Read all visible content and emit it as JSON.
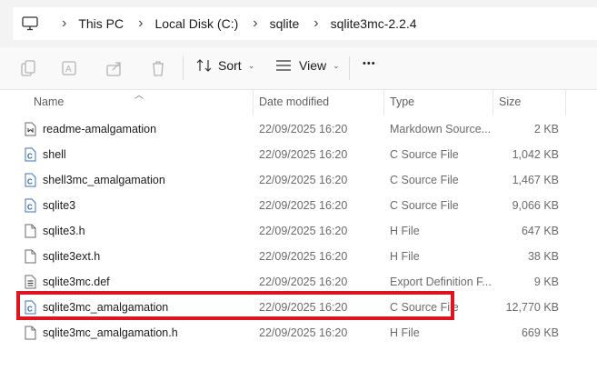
{
  "breadcrumb": [
    "This PC",
    "Local Disk (C:)",
    "sqlite",
    "sqlite3mc-2.2.4"
  ],
  "toolbar": {
    "sort_label": "Sort",
    "view_label": "View",
    "more_label": "•••"
  },
  "columns": {
    "name": "Name",
    "date": "Date modified",
    "type": "Type",
    "size": "Size"
  },
  "files": [
    {
      "name": "readme-amalgamation",
      "date": "22/09/2025 16:20",
      "type": "Markdown Source...",
      "size": "2 KB",
      "icon": "markdown-file-icon"
    },
    {
      "name": "shell",
      "date": "22/09/2025 16:20",
      "type": "C Source File",
      "size": "1,042 KB",
      "icon": "c-source-file-icon"
    },
    {
      "name": "shell3mc_amalgamation",
      "date": "22/09/2025 16:20",
      "type": "C Source File",
      "size": "1,467 KB",
      "icon": "c-source-file-icon"
    },
    {
      "name": "sqlite3",
      "date": "22/09/2025 16:20",
      "type": "C Source File",
      "size": "9,066 KB",
      "icon": "c-source-file-icon"
    },
    {
      "name": "sqlite3.h",
      "date": "22/09/2025 16:20",
      "type": "H File",
      "size": "647 KB",
      "icon": "blank-file-icon"
    },
    {
      "name": "sqlite3ext.h",
      "date": "22/09/2025 16:20",
      "type": "H File",
      "size": "38 KB",
      "icon": "blank-file-icon"
    },
    {
      "name": "sqlite3mc.def",
      "date": "22/09/2025 16:20",
      "type": "Export Definition F...",
      "size": "9 KB",
      "icon": "def-file-icon"
    },
    {
      "name": "sqlite3mc_amalgamation",
      "date": "22/09/2025 16:20",
      "type": "C Source File",
      "size": "12,770 KB",
      "icon": "c-source-file-icon"
    },
    {
      "name": "sqlite3mc_amalgamation.h",
      "date": "22/09/2025 16:20",
      "type": "H File",
      "size": "669 KB",
      "icon": "blank-file-icon"
    }
  ],
  "colors": {
    "highlight": "#e0141e",
    "accent": "#0067c0"
  }
}
